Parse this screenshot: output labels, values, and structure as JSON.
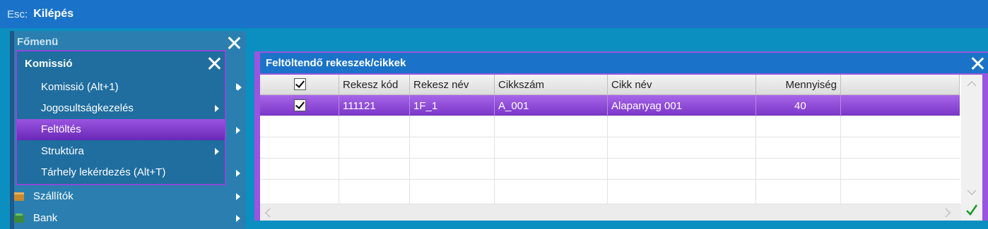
{
  "topbar": {
    "esc": "Esc:",
    "exit_label": "Kilépés"
  },
  "main_menu": {
    "title": "Főmenü",
    "items": [
      {
        "label": "Szállítók",
        "icon": "box-icon"
      },
      {
        "label": "Bank",
        "icon": "bank-icon"
      }
    ]
  },
  "sub_menu": {
    "title": "Komissió",
    "items": [
      {
        "label": "Komissió (Alt+1)"
      },
      {
        "label": "Jogosultságkezelés"
      },
      {
        "label": "Feltöltés",
        "active": true
      },
      {
        "label": "Struktúra"
      },
      {
        "label": "Tárhely lekérdezés (Alt+T)"
      }
    ]
  },
  "window": {
    "title": "Feltöltendő rekeszek/cikkek",
    "columns": [
      "",
      "Rekesz kód",
      "Rekesz név",
      "Cikkszám",
      "Cikk név",
      "Mennyiség"
    ],
    "rows": [
      {
        "checked": true,
        "rekesz_kod": "111121",
        "rekesz_nev": "1F_1",
        "cikkszam": "A_001",
        "cikk_nev": "Alapanyag 001",
        "mennyiseg": "40"
      }
    ]
  },
  "colors": {
    "topbar": "#1a73c8",
    "accent": "#9a55e0",
    "background": "#0a8fc0"
  }
}
